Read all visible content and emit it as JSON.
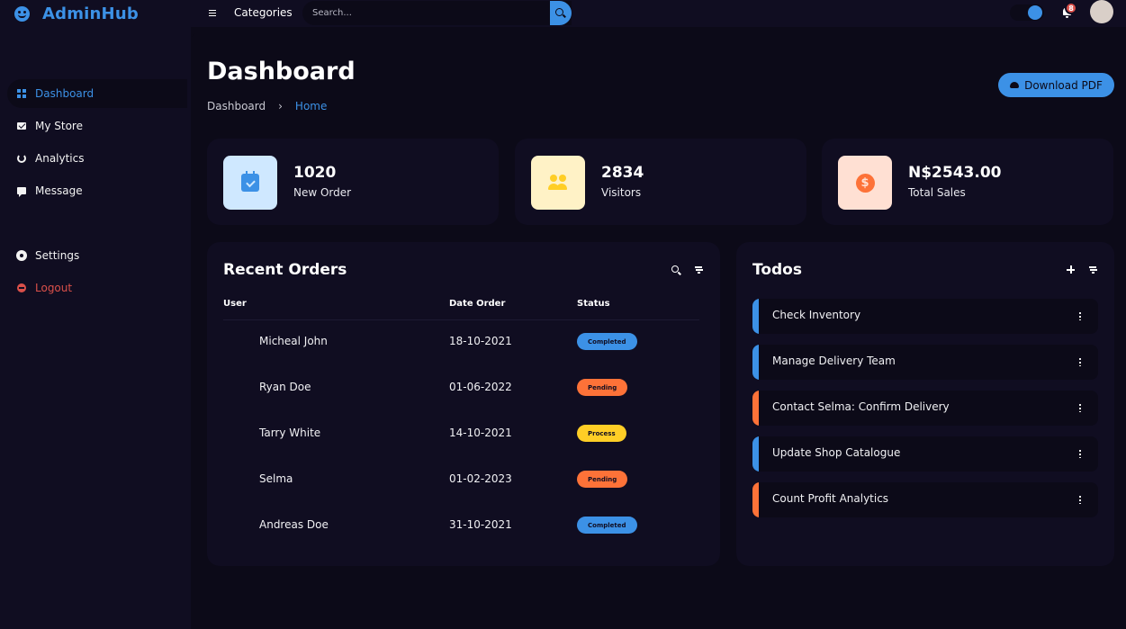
{
  "brand": {
    "name": "AdminHub",
    "icon": "smiley-icon",
    "accent": "#3c91e6"
  },
  "sidebar": {
    "items": [
      {
        "label": "Dashboard",
        "icon": "grid-icon",
        "active": true
      },
      {
        "label": "My Store",
        "icon": "store-icon"
      },
      {
        "label": "Analytics",
        "icon": "analytics-icon"
      },
      {
        "label": "Message",
        "icon": "message-icon"
      }
    ],
    "bottom_items": [
      {
        "label": "Settings",
        "icon": "gear-icon"
      },
      {
        "label": "Logout",
        "icon": "logout-icon",
        "color": "#db504a"
      }
    ]
  },
  "topnav": {
    "categories_label": "Categories",
    "search_placeholder": "Search...",
    "notification_count": "8"
  },
  "header": {
    "title": "Dashboard",
    "breadcrumb": [
      "Dashboard",
      "Home"
    ],
    "download_label": "Download PDF"
  },
  "stats": [
    {
      "value": "1020",
      "label": "New Order",
      "icon": "calendar-check-icon",
      "bg": "#cfe8ff"
    },
    {
      "value": "2834",
      "label": "Visitors",
      "icon": "people-icon",
      "bg": "#fff2c6"
    },
    {
      "value": "N$2543.00",
      "label": "Total Sales",
      "icon": "dollar-circle-icon",
      "bg": "#ffe0d3"
    }
  ],
  "orders": {
    "title": "Recent Orders",
    "columns": [
      "User",
      "Date Order",
      "Status"
    ],
    "rows": [
      {
        "user": "Micheal John",
        "date": "18-10-2021",
        "status": "Completed"
      },
      {
        "user": "Ryan Doe",
        "date": "01-06-2022",
        "status": "Pending"
      },
      {
        "user": "Tarry White",
        "date": "14-10-2021",
        "status": "Process"
      },
      {
        "user": "Selma",
        "date": "01-02-2023",
        "status": "Pending"
      },
      {
        "user": "Andreas Doe",
        "date": "31-10-2021",
        "status": "Completed"
      }
    ]
  },
  "todos": {
    "title": "Todos",
    "items": [
      {
        "text": "Check Inventory",
        "state": "completed"
      },
      {
        "text": "Manage Delivery Team",
        "state": "completed"
      },
      {
        "text": "Contact Selma: Confirm Delivery",
        "state": "not-completed"
      },
      {
        "text": "Update Shop Catalogue",
        "state": "completed"
      },
      {
        "text": "Count Profit Analytics",
        "state": "not-completed"
      }
    ]
  },
  "colors": {
    "completed": "#3c91e6",
    "pending": "#fd7238",
    "process": "#ffce26",
    "not_completed": "#fd7238"
  }
}
